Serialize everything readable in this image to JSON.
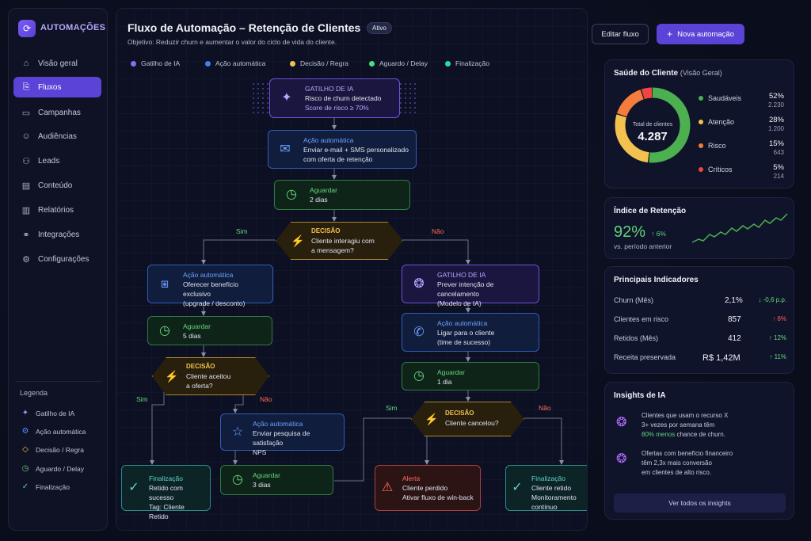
{
  "sidebar": {
    "brand": "AUTOMAÇÕES",
    "items": [
      {
        "label": "Visão geral",
        "icon": "home-icon"
      },
      {
        "label": "Fluxos",
        "icon": "flow-icon"
      },
      {
        "label": "Campanhas",
        "icon": "campaign-icon"
      },
      {
        "label": "Audiências",
        "icon": "audience-icon"
      },
      {
        "label": "Leads",
        "icon": "leads-icon"
      },
      {
        "label": "Conteúdo",
        "icon": "content-icon"
      },
      {
        "label": "Relatórios",
        "icon": "reports-icon"
      },
      {
        "label": "Integrações",
        "icon": "integrations-icon"
      },
      {
        "label": "Configurações",
        "icon": "settings-icon"
      }
    ],
    "legend_title": "Legenda",
    "legend": [
      "Gatilho de IA",
      "Ação automática",
      "Decisão / Regra",
      "Aguardo / Delay",
      "Finalização"
    ]
  },
  "header": {
    "title": "Fluxo de Automação – Retenção de Clientes",
    "badge": "Ativo",
    "subtitle": "Objetivo: Reduzir churn e aumentar o valor do ciclo de vida do cliente.",
    "filters": [
      "Gatilho de IA",
      "Ação automática",
      "Decisão / Regra",
      "Aguardo / Delay",
      "Finalização"
    ],
    "edit_button": "Editar fluxo",
    "new_button": "Nova automação"
  },
  "colors": {
    "ia": "#8b6cf0",
    "acao": "#3b82f6",
    "decisao": "#f2c14e",
    "aguardo": "#4ade80",
    "final": "#2dd4bf",
    "accent": "#5b43d8"
  },
  "flow": {
    "n1": {
      "type": "GATILHO DE IA",
      "l1": "Risco de churn detectado",
      "l2": "Score de risco ≥ 70%"
    },
    "n2": {
      "type": "Ação automática",
      "l1": "Enviar e-mail + SMS personalizado",
      "l2": "com oferta de retenção"
    },
    "n3": {
      "type": "Aguardar",
      "l1": "2 dias"
    },
    "d1": {
      "type": "DECISÃO",
      "l1": "Cliente interagiu com",
      "l2": "a mensagem?",
      "yes": "Sim",
      "no": "Não"
    },
    "n4": {
      "type": "Ação automática",
      "l1": "Oferecer benefício exclusivo",
      "l2": "(upgrade / desconto)"
    },
    "n5": {
      "type": "Aguardar",
      "l1": "5 dias"
    },
    "d2": {
      "type": "DECISÃO",
      "l1": "Cliente aceitou",
      "l2": "a oferta?",
      "yes": "Sim",
      "no": "Não"
    },
    "n6": {
      "type": "Finalização",
      "l1": "Retido com sucesso",
      "l2": "Tag: Cliente Retido"
    },
    "n7": {
      "type": "Ação automática",
      "l1": "Enviar pesquisa de satisfação",
      "l2": "NPS"
    },
    "n8": {
      "type": "Aguardar",
      "l1": "3 dias"
    },
    "n9": {
      "type": "GATILHO DE IA",
      "l1": "Prever intenção de cancelamento",
      "l2": "(Modelo de IA)"
    },
    "n10": {
      "type": "Ação automática",
      "l1": "Ligar para o cliente",
      "l2": "(time de sucesso)"
    },
    "n11": {
      "type": "Aguardar",
      "l1": "1 dia"
    },
    "d3": {
      "type": "DECISÃO",
      "l1": "Cliente cancelou?",
      "yes": "Sim",
      "no": "Não"
    },
    "n12": {
      "type": "Alerta",
      "l1": "Cliente perdido",
      "l2": "Ativar fluxo de win-back"
    },
    "n13": {
      "type": "Finalização",
      "l1": "Cliente retido",
      "l2": "Monitoramento contínuo"
    }
  },
  "health": {
    "title": "Saúde do Cliente",
    "title_sub": "(Visão Geral)",
    "center_label": "Total de clientes",
    "center_value": "4.287",
    "rows": [
      {
        "label": "Saudáveis",
        "pct": "52%",
        "count": "2.230",
        "color": "#4caf50"
      },
      {
        "label": "Atenção",
        "pct": "28%",
        "count": "1.200",
        "color": "#f2c14e"
      },
      {
        "label": "Risco",
        "pct": "15%",
        "count": "643",
        "color": "#f47c3c"
      },
      {
        "label": "Críticos",
        "pct": "5%",
        "count": "214",
        "color": "#ef4444"
      }
    ],
    "chart_values": [
      52,
      28,
      15,
      5
    ]
  },
  "retention": {
    "title": "Índice de Retenção",
    "value": "92%",
    "change": "↑ 6%",
    "caption": "vs. período anterior"
  },
  "indicators": {
    "title": "Principais Indicadores",
    "rows": [
      {
        "label": "Churn (Mês)",
        "value": "2,1%",
        "change": "↓ -0,6 p.p."
      },
      {
        "label": "Clientes em risco",
        "value": "857",
        "change": "↑ 8%"
      },
      {
        "label": "Retidos (Mês)",
        "value": "412",
        "change": "↑ 12%"
      },
      {
        "label": "Receita preservada",
        "value": "R$ 1,42M",
        "change": "↑ 11%"
      }
    ]
  },
  "insights": {
    "title": "Insights de IA",
    "i1": {
      "a": "Clientes que usam o recurso X",
      "b": "3+ vezes por semana têm",
      "c": "80% menos",
      "d": "chance de churn."
    },
    "i2": {
      "a": "Ofertas com benefício financeiro",
      "b": "têm 2,3x mais conversão",
      "c": "em clientes de alto risco."
    },
    "button": "Ver todos os insights"
  }
}
